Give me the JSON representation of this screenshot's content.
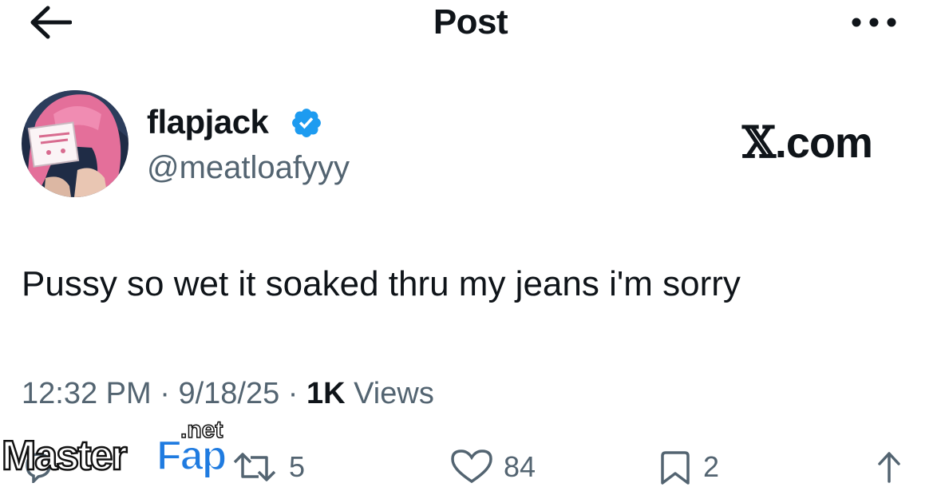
{
  "header": {
    "title": "Post"
  },
  "author": {
    "display_name": "flapjack",
    "handle": "@meatloafyyy"
  },
  "brand": {
    "x_logo": "𝕏",
    "domain_suffix": ".com"
  },
  "post": {
    "text": "Pussy so wet it soaked thru my jeans i'm sorry"
  },
  "meta": {
    "time": "12:32 PM",
    "sep1": " · ",
    "date": "9/18/25",
    "sep2": " · ",
    "views_count": "1K",
    "views_label": " Views"
  },
  "actions": {
    "reposts": "5",
    "likes": "84",
    "bookmarks": "2"
  },
  "watermark": {
    "master": "Master",
    "fap": "Fap",
    "tld": ".net"
  },
  "colors": {
    "text": "#0f1419",
    "muted": "#536471",
    "verified": "#1d9bf0",
    "watermark_blue": "#1f7be0"
  }
}
